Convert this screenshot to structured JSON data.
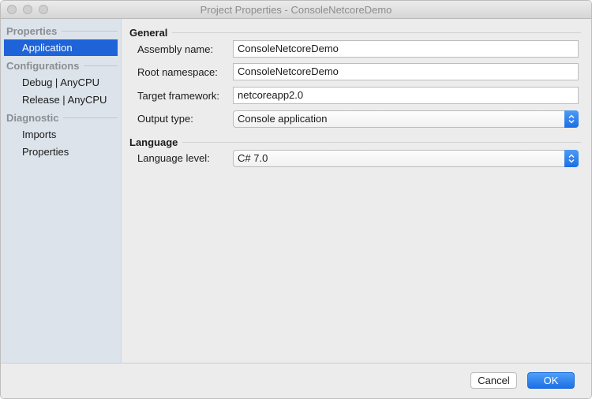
{
  "window": {
    "title": "Project Properties - ConsoleNetcoreDemo"
  },
  "sidebar": {
    "groups": [
      {
        "label": "Properties",
        "items": [
          {
            "label": "Application",
            "selected": true
          }
        ]
      },
      {
        "label": "Configurations",
        "items": [
          {
            "label": "Debug | AnyCPU"
          },
          {
            "label": "Release | AnyCPU"
          }
        ]
      },
      {
        "label": "Diagnostic",
        "items": [
          {
            "label": "Imports"
          },
          {
            "label": "Properties"
          }
        ]
      }
    ]
  },
  "general": {
    "heading": "General",
    "assembly_name": {
      "label": "Assembly name:",
      "value": "ConsoleNetcoreDemo"
    },
    "root_namespace": {
      "label": "Root namespace:",
      "value": "ConsoleNetcoreDemo"
    },
    "target_framework": {
      "label": "Target framework:",
      "value": "netcoreapp2.0"
    },
    "output_type": {
      "label": "Output type:",
      "value": "Console application"
    }
  },
  "language": {
    "heading": "Language",
    "language_level": {
      "label": "Language level:",
      "value": "C# 7.0"
    }
  },
  "footer": {
    "cancel_label": "Cancel",
    "ok_label": "OK"
  },
  "colors": {
    "accent": "#1e63d8",
    "sidebar_bg": "#dce3ea",
    "window_bg": "#ececec"
  }
}
